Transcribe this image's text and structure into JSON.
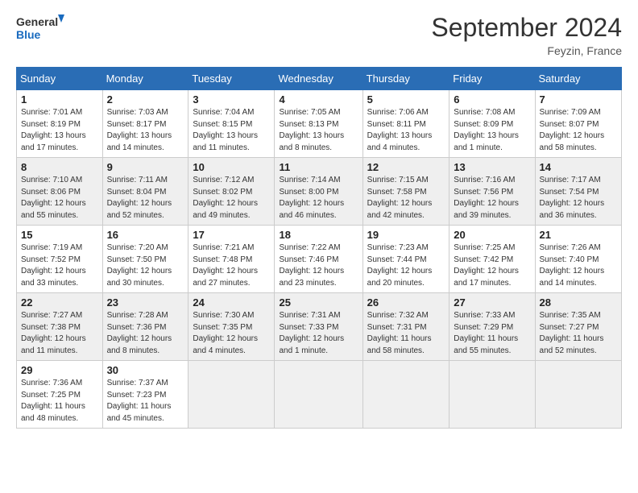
{
  "header": {
    "logo_general": "General",
    "logo_blue": "Blue",
    "month_title": "September 2024",
    "location": "Feyzin, France"
  },
  "days_of_week": [
    "Sunday",
    "Monday",
    "Tuesday",
    "Wednesday",
    "Thursday",
    "Friday",
    "Saturday"
  ],
  "weeks": [
    [
      {
        "day": 1,
        "sunrise": "7:01 AM",
        "sunset": "8:19 PM",
        "daylight": "13 hours and 17 minutes."
      },
      {
        "day": 2,
        "sunrise": "7:03 AM",
        "sunset": "8:17 PM",
        "daylight": "13 hours and 14 minutes."
      },
      {
        "day": 3,
        "sunrise": "7:04 AM",
        "sunset": "8:15 PM",
        "daylight": "13 hours and 11 minutes."
      },
      {
        "day": 4,
        "sunrise": "7:05 AM",
        "sunset": "8:13 PM",
        "daylight": "13 hours and 8 minutes."
      },
      {
        "day": 5,
        "sunrise": "7:06 AM",
        "sunset": "8:11 PM",
        "daylight": "13 hours and 4 minutes."
      },
      {
        "day": 6,
        "sunrise": "7:08 AM",
        "sunset": "8:09 PM",
        "daylight": "13 hours and 1 minute."
      },
      {
        "day": 7,
        "sunrise": "7:09 AM",
        "sunset": "8:07 PM",
        "daylight": "12 hours and 58 minutes."
      }
    ],
    [
      {
        "day": 8,
        "sunrise": "7:10 AM",
        "sunset": "8:06 PM",
        "daylight": "12 hours and 55 minutes."
      },
      {
        "day": 9,
        "sunrise": "7:11 AM",
        "sunset": "8:04 PM",
        "daylight": "12 hours and 52 minutes."
      },
      {
        "day": 10,
        "sunrise": "7:12 AM",
        "sunset": "8:02 PM",
        "daylight": "12 hours and 49 minutes."
      },
      {
        "day": 11,
        "sunrise": "7:14 AM",
        "sunset": "8:00 PM",
        "daylight": "12 hours and 46 minutes."
      },
      {
        "day": 12,
        "sunrise": "7:15 AM",
        "sunset": "7:58 PM",
        "daylight": "12 hours and 42 minutes."
      },
      {
        "day": 13,
        "sunrise": "7:16 AM",
        "sunset": "7:56 PM",
        "daylight": "12 hours and 39 minutes."
      },
      {
        "day": 14,
        "sunrise": "7:17 AM",
        "sunset": "7:54 PM",
        "daylight": "12 hours and 36 minutes."
      }
    ],
    [
      {
        "day": 15,
        "sunrise": "7:19 AM",
        "sunset": "7:52 PM",
        "daylight": "12 hours and 33 minutes."
      },
      {
        "day": 16,
        "sunrise": "7:20 AM",
        "sunset": "7:50 PM",
        "daylight": "12 hours and 30 minutes."
      },
      {
        "day": 17,
        "sunrise": "7:21 AM",
        "sunset": "7:48 PM",
        "daylight": "12 hours and 27 minutes."
      },
      {
        "day": 18,
        "sunrise": "7:22 AM",
        "sunset": "7:46 PM",
        "daylight": "12 hours and 23 minutes."
      },
      {
        "day": 19,
        "sunrise": "7:23 AM",
        "sunset": "7:44 PM",
        "daylight": "12 hours and 20 minutes."
      },
      {
        "day": 20,
        "sunrise": "7:25 AM",
        "sunset": "7:42 PM",
        "daylight": "12 hours and 17 minutes."
      },
      {
        "day": 21,
        "sunrise": "7:26 AM",
        "sunset": "7:40 PM",
        "daylight": "12 hours and 14 minutes."
      }
    ],
    [
      {
        "day": 22,
        "sunrise": "7:27 AM",
        "sunset": "7:38 PM",
        "daylight": "12 hours and 11 minutes."
      },
      {
        "day": 23,
        "sunrise": "7:28 AM",
        "sunset": "7:36 PM",
        "daylight": "12 hours and 8 minutes."
      },
      {
        "day": 24,
        "sunrise": "7:30 AM",
        "sunset": "7:35 PM",
        "daylight": "12 hours and 4 minutes."
      },
      {
        "day": 25,
        "sunrise": "7:31 AM",
        "sunset": "7:33 PM",
        "daylight": "12 hours and 1 minute."
      },
      {
        "day": 26,
        "sunrise": "7:32 AM",
        "sunset": "7:31 PM",
        "daylight": "11 hours and 58 minutes."
      },
      {
        "day": 27,
        "sunrise": "7:33 AM",
        "sunset": "7:29 PM",
        "daylight": "11 hours and 55 minutes."
      },
      {
        "day": 28,
        "sunrise": "7:35 AM",
        "sunset": "7:27 PM",
        "daylight": "11 hours and 52 minutes."
      }
    ],
    [
      {
        "day": 29,
        "sunrise": "7:36 AM",
        "sunset": "7:25 PM",
        "daylight": "11 hours and 48 minutes."
      },
      {
        "day": 30,
        "sunrise": "7:37 AM",
        "sunset": "7:23 PM",
        "daylight": "11 hours and 45 minutes."
      },
      null,
      null,
      null,
      null,
      null
    ]
  ]
}
